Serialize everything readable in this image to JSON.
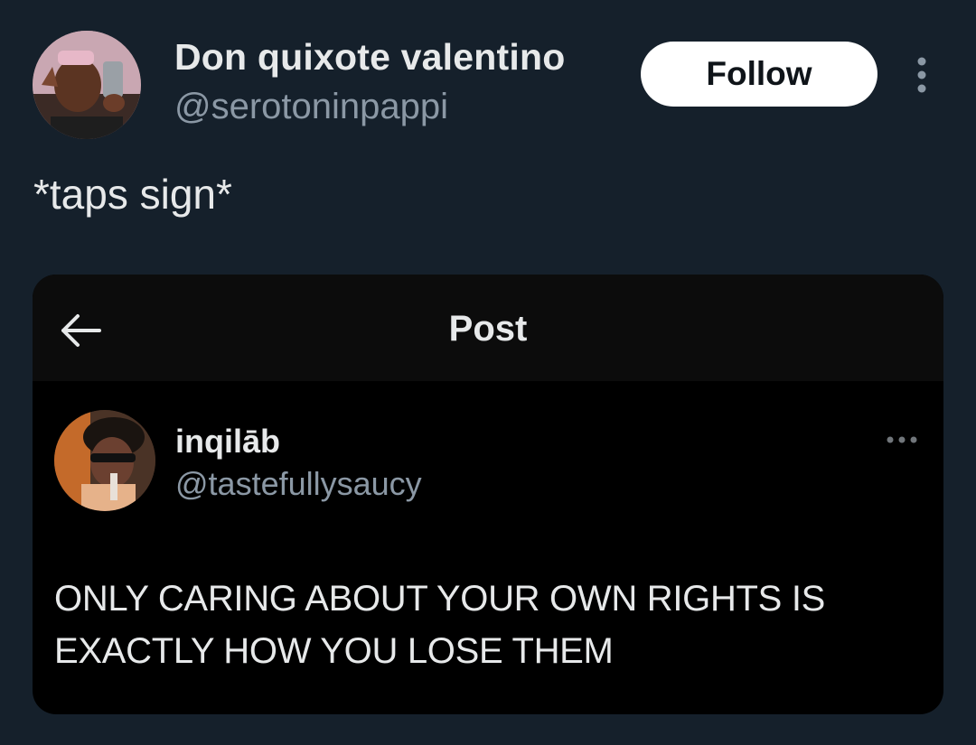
{
  "tweet": {
    "author": {
      "display_name": "Don quixote valentino",
      "handle": "@serotoninpappi",
      "avatar_icon": "profile-photo"
    },
    "follow_label": "Follow",
    "more_icon": "more-vertical-icon",
    "text": "*taps sign*"
  },
  "embedded_post": {
    "header": {
      "back_icon": "arrow-left-icon",
      "title": "Post"
    },
    "author": {
      "display_name": "inqilāb",
      "handle": "@tastefullysaucy",
      "avatar_icon": "profile-photo"
    },
    "more_icon": "more-horizontal-icon",
    "text_line_1": "ONLY CARING ABOUT YOUR OWN RIGHTS IS",
    "text_line_2": "EXACTLY HOW YOU LOSE THEM"
  },
  "colors": {
    "background": "#15202b",
    "primary_text": "#e7e9ea",
    "secondary_text": "#8b98a5",
    "card_background": "#000000",
    "button_background": "#ffffff"
  }
}
